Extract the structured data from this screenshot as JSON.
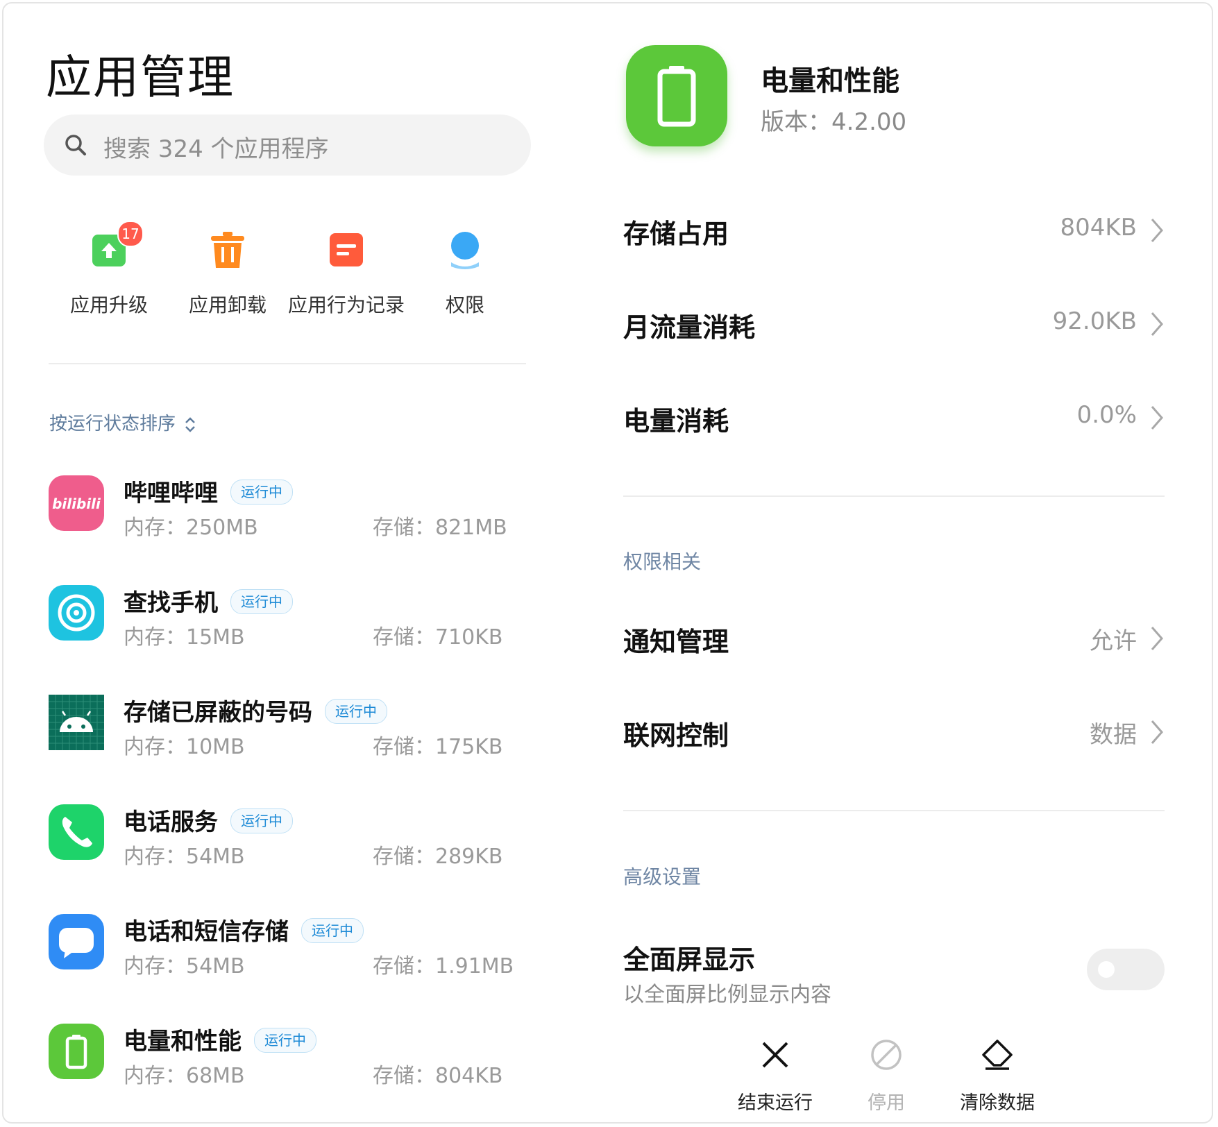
{
  "left": {
    "title": "应用管理",
    "search_placeholder": "搜索 324 个应用程序",
    "shortcuts": [
      {
        "label": "应用升级",
        "icon": "app-upgrade-icon",
        "badge": "17",
        "color": "#4cd05c"
      },
      {
        "label": "应用卸载",
        "icon": "app-uninstall-icon",
        "color": "#ff8a1f"
      },
      {
        "label": "应用行为记录",
        "icon": "app-behavior-record-icon",
        "color": "#ff5b3b"
      },
      {
        "label": "权限",
        "icon": "permissions-icon",
        "color": "#3aa8f5"
      }
    ],
    "sort_label": "按运行状态排序",
    "apps": [
      {
        "name": "哔哩哔哩",
        "status": "运行中",
        "memory": "内存：250MB",
        "storage": "存储：821MB",
        "icon": "bilibili-icon",
        "color": "#ef5d8c"
      },
      {
        "name": "查找手机",
        "status": "运行中",
        "memory": "内存：15MB",
        "storage": "存储：710KB",
        "icon": "find-phone-icon",
        "color": "#1ec3e0"
      },
      {
        "name": "存储已屏蔽的号码",
        "status": "运行中",
        "memory": "内存：10MB",
        "storage": "存储：175KB",
        "icon": "android-icon",
        "color": "#0b6e5a"
      },
      {
        "name": "电话服务",
        "status": "运行中",
        "memory": "内存：54MB",
        "storage": "存储：289KB",
        "icon": "phone-icon",
        "color": "#1ed36a"
      },
      {
        "name": "电话和短信存储",
        "status": "运行中",
        "memory": "内存：54MB",
        "storage": "存储：1.91MB",
        "icon": "message-icon",
        "color": "#2f8cf5"
      },
      {
        "name": "电量和性能",
        "status": "运行中",
        "memory": "内存：68MB",
        "storage": "存储：804KB",
        "icon": "battery-icon",
        "color": "#5cc83a"
      }
    ]
  },
  "right": {
    "app_name": "电量和性能",
    "version": "版本：4.2.00",
    "icon": "battery-icon",
    "rows": [
      {
        "label": "存储占用",
        "value": "804KB"
      },
      {
        "label": "月流量消耗",
        "value": "92.0KB"
      },
      {
        "label": "电量消耗",
        "value": "0.0%"
      }
    ],
    "permissions_section": "权限相关",
    "permission_rows": [
      {
        "label": "通知管理",
        "value": "允许"
      },
      {
        "label": "联网控制",
        "value": "数据"
      }
    ],
    "advanced_section": "高级设置",
    "fullscreen": {
      "title": "全面屏显示",
      "subtitle": "以全面屏比例显示内容",
      "enabled": false
    },
    "actions": [
      {
        "label": "结束运行",
        "icon": "close-icon",
        "enabled": true
      },
      {
        "label": "停用",
        "icon": "disable-icon",
        "enabled": false
      },
      {
        "label": "清除数据",
        "icon": "eraser-icon",
        "enabled": true
      }
    ]
  }
}
